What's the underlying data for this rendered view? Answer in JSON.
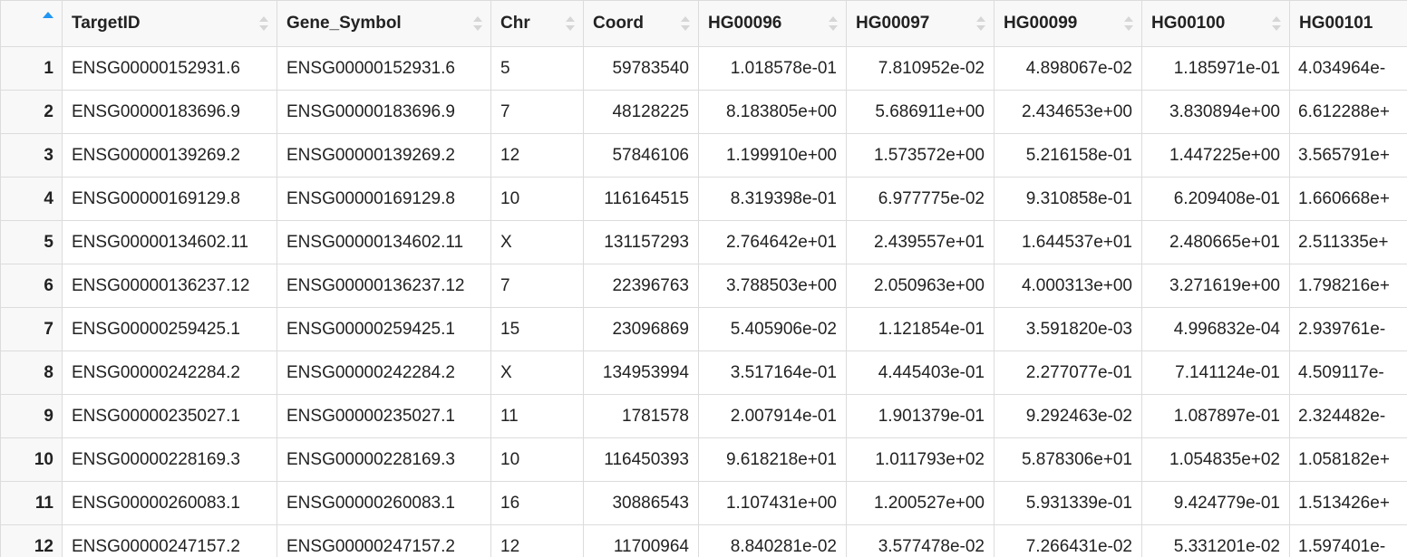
{
  "table": {
    "columns": [
      "TargetID",
      "Gene_Symbol",
      "Chr",
      "Coord",
      "HG00096",
      "HG00097",
      "HG00099",
      "HG00100",
      "HG00101"
    ],
    "rows": [
      {
        "num": "1",
        "cells": [
          "ENSG00000152931.6",
          "ENSG00000152931.6",
          "5",
          "59783540",
          "1.018578e-01",
          "7.810952e-02",
          "4.898067e-02",
          "1.185971e-01",
          "4.034964e-"
        ]
      },
      {
        "num": "2",
        "cells": [
          "ENSG00000183696.9",
          "ENSG00000183696.9",
          "7",
          "48128225",
          "8.183805e+00",
          "5.686911e+00",
          "2.434653e+00",
          "3.830894e+00",
          "6.612288e+"
        ]
      },
      {
        "num": "3",
        "cells": [
          "ENSG00000139269.2",
          "ENSG00000139269.2",
          "12",
          "57846106",
          "1.199910e+00",
          "1.573572e+00",
          "5.216158e-01",
          "1.447225e+00",
          "3.565791e+"
        ]
      },
      {
        "num": "4",
        "cells": [
          "ENSG00000169129.8",
          "ENSG00000169129.8",
          "10",
          "116164515",
          "8.319398e-01",
          "6.977775e-02",
          "9.310858e-01",
          "6.209408e-01",
          "1.660668e+"
        ]
      },
      {
        "num": "5",
        "cells": [
          "ENSG00000134602.11",
          "ENSG00000134602.11",
          "X",
          "131157293",
          "2.764642e+01",
          "2.439557e+01",
          "1.644537e+01",
          "2.480665e+01",
          "2.511335e+"
        ]
      },
      {
        "num": "6",
        "cells": [
          "ENSG00000136237.12",
          "ENSG00000136237.12",
          "7",
          "22396763",
          "3.788503e+00",
          "2.050963e+00",
          "4.000313e+00",
          "3.271619e+00",
          "1.798216e+"
        ]
      },
      {
        "num": "7",
        "cells": [
          "ENSG00000259425.1",
          "ENSG00000259425.1",
          "15",
          "23096869",
          "5.405906e-02",
          "1.121854e-01",
          "3.591820e-03",
          "4.996832e-04",
          "2.939761e-"
        ]
      },
      {
        "num": "8",
        "cells": [
          "ENSG00000242284.2",
          "ENSG00000242284.2",
          "X",
          "134953994",
          "3.517164e-01",
          "4.445403e-01",
          "2.277077e-01",
          "7.141124e-01",
          "4.509117e-"
        ]
      },
      {
        "num": "9",
        "cells": [
          "ENSG00000235027.1",
          "ENSG00000235027.1",
          "11",
          "1781578",
          "2.007914e-01",
          "1.901379e-01",
          "9.292463e-02",
          "1.087897e-01",
          "2.324482e-"
        ]
      },
      {
        "num": "10",
        "cells": [
          "ENSG00000228169.3",
          "ENSG00000228169.3",
          "10",
          "116450393",
          "9.618218e+01",
          "1.011793e+02",
          "5.878306e+01",
          "1.054835e+02",
          "1.058182e+"
        ]
      },
      {
        "num": "11",
        "cells": [
          "ENSG00000260083.1",
          "ENSG00000260083.1",
          "16",
          "30886543",
          "1.107431e+00",
          "1.200527e+00",
          "5.931339e-01",
          "9.424779e-01",
          "1.513426e+"
        ]
      },
      {
        "num": "12",
        "cells": [
          "ENSG00000247157.2",
          "ENSG00000247157.2",
          "12",
          "11700964",
          "8.840281e-02",
          "3.577478e-02",
          "7.266431e-02",
          "5.331201e-02",
          "1.597401e-"
        ]
      }
    ]
  },
  "colors": {
    "header_bg": "#f8f8f8",
    "grid_line": "#dcdcdc",
    "sort_active": "#2196f3",
    "sort_inactive": "#d6d6d6"
  },
  "icons": {
    "index_sort": "sort-ascending-icon",
    "column_sort": "sort-toggle-icon"
  }
}
